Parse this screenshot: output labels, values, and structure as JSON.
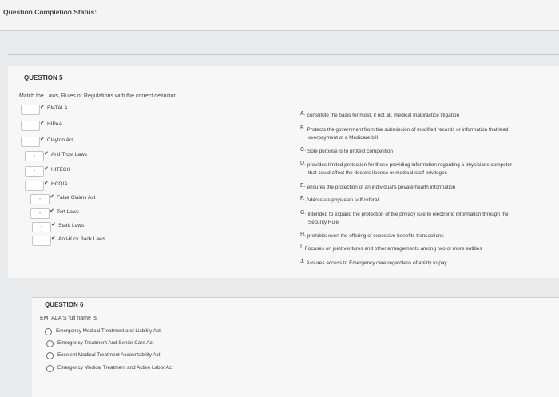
{
  "status_label": "Question Completion Status:",
  "q5": {
    "header": "QUESTION 5",
    "prompt": "Match the Laws, Rules or Regulations with the correct definition",
    "terms": [
      "EMTALA",
      "HIPAA",
      "Clayton Act",
      "Anti-Trust Laws",
      "HITECH",
      "HCQIA",
      "False Claims Act",
      "Tort Laws",
      "Stark Laws",
      "Anti-Kick Back Laws"
    ],
    "definitions": [
      {
        "letter": "A.",
        "lines": [
          "constitute the basis for most, if not all, medical malpractice litigation"
        ]
      },
      {
        "letter": "B.",
        "lines": [
          "Protects the government from the submission of modified records or information that lead",
          "overpayment of a Medicare bill"
        ]
      },
      {
        "letter": "C.",
        "lines": [
          "Sole purpose is to protect competition"
        ]
      },
      {
        "letter": "D.",
        "lines": [
          "provides limited protection for those providing information regarding a physicians competer",
          "that could effect the doctors license or medical staff privileges"
        ]
      },
      {
        "letter": "E.",
        "lines": [
          "ensures the protection of an individual's private health information"
        ]
      },
      {
        "letter": "F.",
        "lines": [
          "Addresses physician self-referal"
        ]
      },
      {
        "letter": "G.",
        "lines": [
          "Intended to expand the protection of the privacy rule to electronic information through the",
          "Security Rule"
        ]
      },
      {
        "letter": "H.",
        "lines": [
          "prohibits even the offering of excessive benefits transactions"
        ]
      },
      {
        "letter": "I.",
        "lines": [
          "Focuses on joint ventures and other arrangements among two or more entities"
        ]
      },
      {
        "letter": "J.",
        "lines": [
          "Assures access to Emergency care regardless of ability to pay"
        ]
      }
    ]
  },
  "q6": {
    "header": "QUESTION 6",
    "prompt": "EMTALA'S full name is",
    "options": [
      "Emergency Medical Treatment and Liability Act",
      "Emergency Treatment And Senior Care Act",
      "Excelent Medical Treatment Accountability Act",
      "Emergency Medical Treatment and Active Labor Act"
    ]
  }
}
